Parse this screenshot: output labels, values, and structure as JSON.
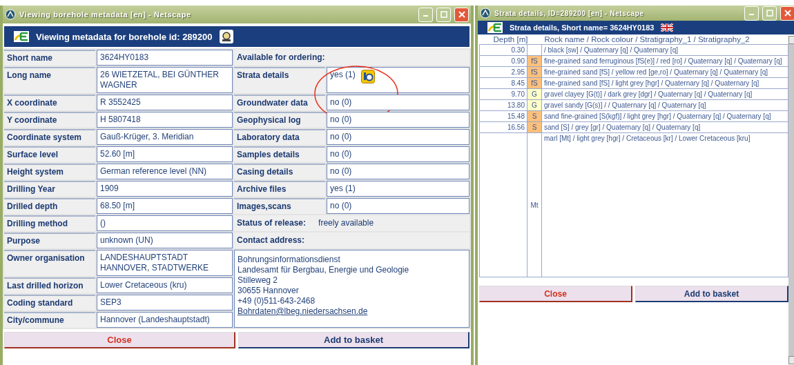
{
  "metadata_window": {
    "title": "Viewing borehole metadata [en] - Netscape",
    "header": {
      "title": "Viewing metadata for borehole id: 289200"
    },
    "fields": [
      {
        "label": "Short name",
        "value": "3624HY0183"
      },
      {
        "label": "Long name",
        "value": "26 WIETZETAL, BEI GÜNTHER WAGNER"
      },
      {
        "label": "X coordinate",
        "value": "R 3552425"
      },
      {
        "label": "Y coordinate",
        "value": "H 5807418"
      },
      {
        "label": "Coordinate system",
        "value": "Gauß-Krüger, 3. Meridian"
      },
      {
        "label": "Surface level",
        "value": "52.60 [m]"
      },
      {
        "label": "Height system",
        "value": "German reference level (NN)"
      },
      {
        "label": "Drilling Year",
        "value": "1909"
      },
      {
        "label": "Drilled depth",
        "value": "68.50 [m]"
      },
      {
        "label": "Drilling method",
        "value": "()"
      },
      {
        "label": "Purpose",
        "value": "unknown (UN)"
      },
      {
        "label": "Owner organisation",
        "value": "LANDESHAUPTSTADT HANNOVER, STADTWERKE"
      },
      {
        "label": "Last drilled horizon",
        "value": "Lower Cretaceous (kru)"
      },
      {
        "label": "Coding standard",
        "value": "SEP3"
      },
      {
        "label": "City/commune",
        "value": "Hannover (Landeshauptstadt)"
      }
    ],
    "ordering": {
      "title": "Available for ordering:",
      "items": [
        {
          "label": "Strata details",
          "value": "yes (1)",
          "kind": "viewable"
        },
        {
          "label": "Groundwater data",
          "value": "no (0)",
          "kind": "plain"
        },
        {
          "label": "Geophysical log",
          "value": "no (0)",
          "kind": "plain"
        },
        {
          "label": "Laboratory data",
          "value": "no (0)",
          "kind": "plain"
        },
        {
          "label": "Samples details",
          "value": "no (0)",
          "kind": "plain"
        },
        {
          "label": "Casing details",
          "value": "no (0)",
          "kind": "plain"
        },
        {
          "label": "Archive files",
          "value": "yes (1)",
          "kind": "plain"
        },
        {
          "label": "Images,scans",
          "value": "no (0)",
          "kind": "plain"
        }
      ]
    },
    "release": {
      "label": "Status of release:",
      "value": "freely available"
    },
    "contact": {
      "title": "Contact address:",
      "lines": [
        "Bohrungsinformationsdienst",
        "Landesamt für Bergbau, Energie und Geologie",
        "Stilleweg 2",
        "30655 Hannover",
        "+49 (0)511-643-2468"
      ],
      "email": "Bohrdaten@lbeg.niedersachsen.de"
    },
    "buttons": [
      {
        "label": "Close",
        "kind": "close"
      },
      {
        "label": "Add to basket",
        "kind": "basket"
      }
    ]
  },
  "strata_window": {
    "title": "Strata details, ID=289200 [en] - Netscape",
    "header": {
      "title": "Strata details, Short name= 3624HY0183"
    },
    "columns": [
      "Depth [m]",
      "Rock name / Rock colour / Stratigraphy_1 / Stratigraphy_2"
    ],
    "rows": [
      {
        "depth": "0.30",
        "description": "/ black [sw] / Quaternary [q] / Quaternary [q]"
      },
      {
        "depth": "0.90",
        "code": "fS",
        "color": "#fcc07c",
        "description": "fine-grained sand ferruginous [fS(e)] / red [ro] / Quaternary [q] / Quaternary [q]"
      },
      {
        "depth": "2.95",
        "code": "fS",
        "color": "#fcc07c",
        "description": "fine-grained sand [fS] / yellow red [ge,ro] / Quaternary [q] / Quaternary [q]"
      },
      {
        "depth": "8.45",
        "code": "fS",
        "color": "#fcc07c",
        "description": "fine-grained sand [fS] / light grey [hgr] / Quaternary [q] / Quaternary [q]"
      },
      {
        "depth": "9.70",
        "code": "G",
        "color": "#ffffc8",
        "description": "gravel clayey [G(t)] / dark grey [dgr] / Quaternary [q] / Quaternary [q]"
      },
      {
        "depth": "13.80",
        "code": "G",
        "color": "#ffffc8",
        "description": "gravel sandy [G(s)] / / Quaternary [q] / Quaternary [q]"
      },
      {
        "depth": "15.48",
        "code": "S",
        "color": "#fcc07c",
        "description": "sand fine-grained [S(kgf)] / light grey [hgr] / Quaternary [q] / Quaternary [q]"
      },
      {
        "depth": "16.56",
        "code": "S",
        "color": "#fcc07c",
        "description": "sand [S] / grey [gr] / Quaternary [q] / Quaternary [q]"
      },
      {
        "code": "Mt",
        "color": "#ffffff",
        "description": "marl [Mt] / light grey [hgr] / Cretaceous [kr] / Lower Cretaceous [kru]"
      }
    ],
    "buttons": [
      {
        "label": "Close",
        "kind": "close"
      },
      {
        "label": "Add to basket",
        "kind": "basket"
      }
    ]
  }
}
